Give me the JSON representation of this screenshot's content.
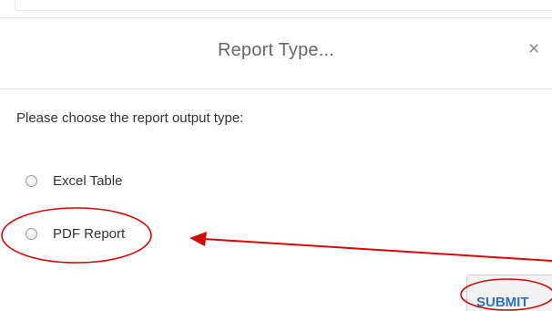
{
  "dialog": {
    "title": "Report Type...",
    "close_glyph": "×",
    "prompt": "Please choose the report output type:",
    "options": [
      {
        "label": "Excel Table",
        "selected": false
      },
      {
        "label": "PDF Report",
        "selected": false
      }
    ],
    "submit_label": "SUBMIT"
  },
  "icons": {
    "close": "close-icon",
    "radio": "radio-button-icon"
  },
  "colors": {
    "title": "#666666",
    "text": "#333333",
    "submit_text": "#2a74c0",
    "annotation": "#d10a0a",
    "divider": "#e5e5e5"
  }
}
